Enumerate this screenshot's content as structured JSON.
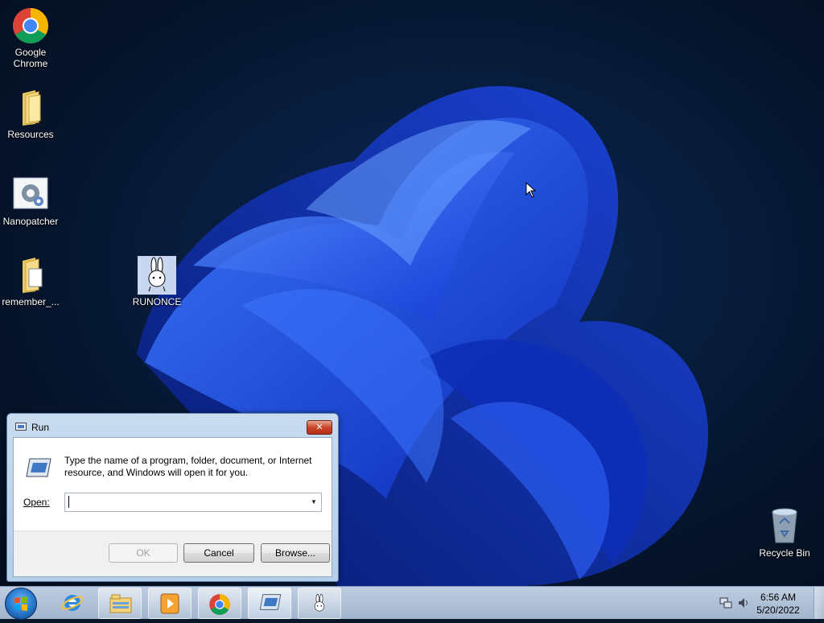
{
  "desktop": {
    "icons": [
      {
        "label": "Google\nChrome",
        "icon": "chrome-icon"
      },
      {
        "label": "Resources",
        "icon": "folder-icon"
      },
      {
        "label": "Nanopatcher",
        "icon": "gear-settings-icon"
      },
      {
        "label": "remember_...",
        "icon": "folder-document-icon"
      },
      {
        "label": "RUNONCE",
        "icon": "rabbit-icon"
      },
      {
        "label": "Recycle Bin",
        "icon": "recycle-bin-icon"
      }
    ]
  },
  "run_dialog": {
    "title": "Run",
    "description": "Type the name of a program, folder, document, or Internet resource, and Windows will open it for you.",
    "open_label": "Open:",
    "open_value": "",
    "ok_label": "OK",
    "cancel_label": "Cancel",
    "browse_label": "Browse...",
    "close_symbol": "✕"
  },
  "taskbar": {
    "items": [
      {
        "name": "internet-explorer-icon"
      },
      {
        "name": "file-explorer-icon"
      },
      {
        "name": "media-player-icon"
      },
      {
        "name": "chrome-icon"
      },
      {
        "name": "run-dialog-icon"
      },
      {
        "name": "rabbit-icon"
      }
    ],
    "clock": {
      "time": "6:56 AM",
      "date": "5/20/2022"
    }
  }
}
